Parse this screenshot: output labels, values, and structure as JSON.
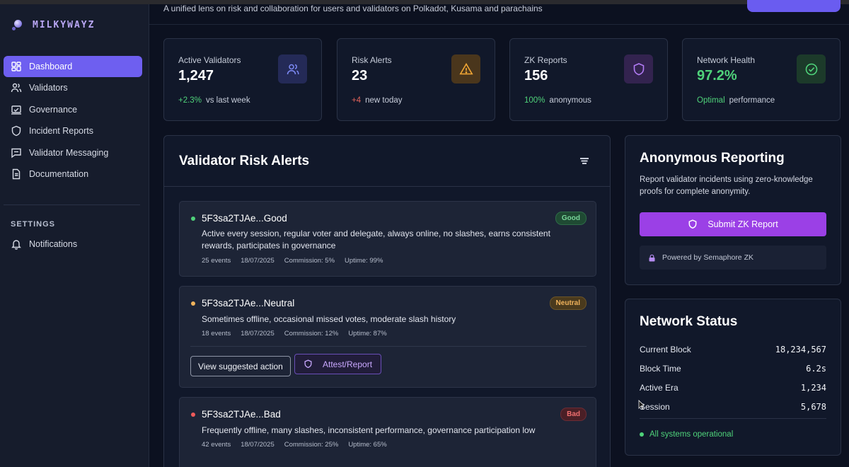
{
  "app": {
    "name": "MILKYWAYZ"
  },
  "header": {
    "subtitle": "A unified lens on risk and collaboration for users and validators on Polkadot, Kusama and parachains"
  },
  "sidebar": {
    "items": [
      {
        "label": "Dashboard",
        "icon": "dashboard-icon",
        "active": true
      },
      {
        "label": "Validators",
        "icon": "users-icon"
      },
      {
        "label": "Governance",
        "icon": "governance-icon"
      },
      {
        "label": "Incident Reports",
        "icon": "shield-icon"
      },
      {
        "label": "Validator Messaging",
        "icon": "message-icon"
      },
      {
        "label": "Documentation",
        "icon": "document-icon"
      }
    ],
    "settings_title": "SETTINGS",
    "settings_items": [
      {
        "label": "Notifications",
        "icon": "bell-icon"
      }
    ]
  },
  "stats": [
    {
      "label": "Active Validators",
      "value": "1,247",
      "delta": "+2.3%",
      "foot": "vs last week",
      "icon": "users-icon",
      "accent": "#6e7cf0"
    },
    {
      "label": "Risk Alerts",
      "value": "23",
      "delta": "+4",
      "foot": "new today",
      "icon": "warning-icon",
      "accent": "#f0a030"
    },
    {
      "label": "ZK Reports",
      "value": "156",
      "delta": "100%",
      "foot": "anonymous",
      "icon": "shield-icon",
      "accent": "#a070f0"
    },
    {
      "label": "Network Health",
      "value": "97.2%",
      "delta": "Optimal",
      "foot": "performance",
      "icon": "check-circle-icon",
      "accent": "#4fd27a"
    }
  ],
  "alerts": {
    "title": "Validator Risk Alerts",
    "items": [
      {
        "name": "5F3sa2TJAe...Good",
        "status": "Good",
        "description": "Active every session, regular voter and delegate, always online, no slashes, earns consistent rewards, participates in governance",
        "events": "25 events",
        "date": "18/07/2025",
        "commission": "Commission: 5%",
        "uptime": "Uptime: 99%"
      },
      {
        "name": "5F3sa2TJAe...Neutral",
        "status": "Neutral",
        "description": "Sometimes offline, occasional missed votes, moderate slash history",
        "events": "18 events",
        "date": "18/07/2025",
        "commission": "Commission: 12%",
        "uptime": "Uptime: 87%",
        "action_label": "View suggested action",
        "attest_label": "Attest/Report"
      },
      {
        "name": "5F3sa2TJAe...Bad",
        "status": "Bad",
        "description": "Frequently offline, many slashes, inconsistent performance, governance participation low",
        "events": "42 events",
        "date": "18/07/2025",
        "commission": "Commission: 25%",
        "uptime": "Uptime: 65%"
      }
    ]
  },
  "reporting": {
    "title": "Anonymous Reporting",
    "description": "Report validator incidents using zero-knowledge proofs for complete anonymity.",
    "button_label": "Submit ZK Report",
    "powered_by": "Powered by Semaphore ZK"
  },
  "network_status": {
    "title": "Network Status",
    "rows": [
      {
        "label": "Current Block",
        "value": "18,234,567"
      },
      {
        "label": "Block Time",
        "value": "6.2s"
      },
      {
        "label": "Active Era",
        "value": "1,234"
      },
      {
        "label": "Session",
        "value": "5,678"
      }
    ],
    "status_text": "All systems operational"
  },
  "colors": {
    "accent": "#6e5ff0",
    "zk_button": "#9b40e6",
    "good": "#4fd27a",
    "neutral": "#f0b35c",
    "bad": "#ef6f6f"
  }
}
